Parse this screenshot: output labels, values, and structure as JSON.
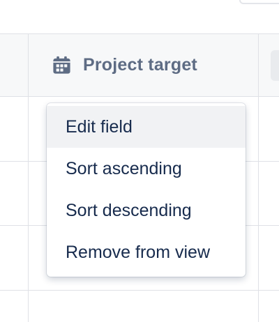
{
  "column": {
    "title": "Project target",
    "icon": "calendar-icon"
  },
  "menu": {
    "items": [
      {
        "label": "Edit field",
        "active": true
      },
      {
        "label": "Sort ascending",
        "active": false
      },
      {
        "label": "Sort descending",
        "active": false
      },
      {
        "label": "Remove from view",
        "active": false
      }
    ]
  },
  "colors": {
    "header_text": "#5e6c84",
    "menu_text": "#172b4d",
    "grid": "#dfe1e6",
    "highlight": "#f1f2f4"
  }
}
